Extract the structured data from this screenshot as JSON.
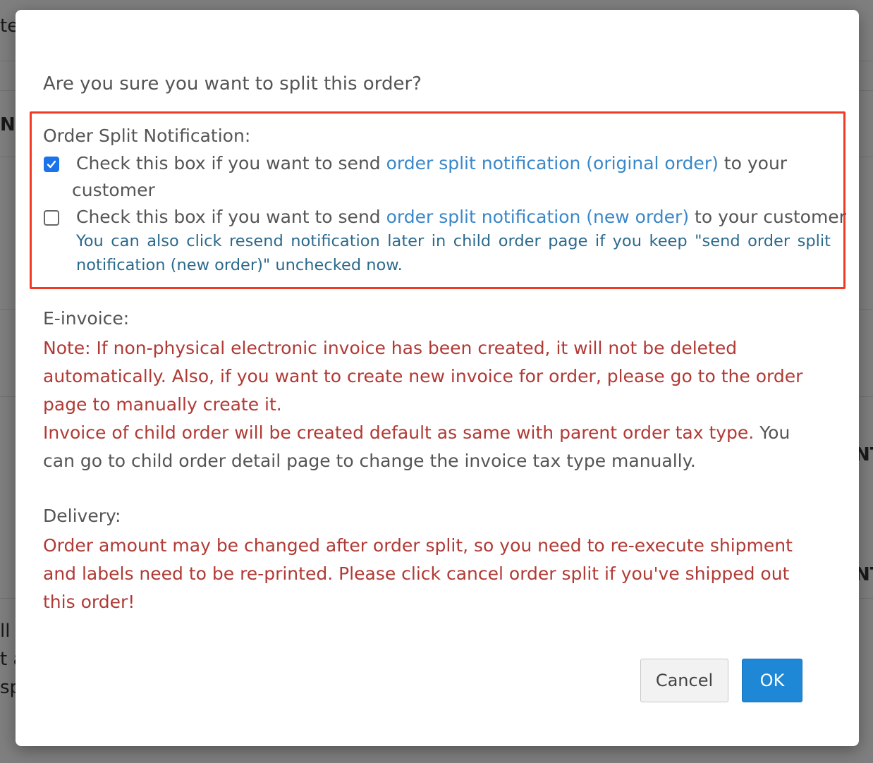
{
  "background": {
    "fragments": [
      "te",
      "Na",
      "NT",
      "NT",
      "ll c",
      "t a",
      "sp"
    ]
  },
  "dialog": {
    "question": "Are you sure you want to split this order?",
    "notification": {
      "title": "Order Split Notification:",
      "option1": {
        "checked": true,
        "prefix": "Check this box if you want to send ",
        "link": "order split notification (original order)",
        "suffix": " to your",
        "continuation": "customer"
      },
      "option2": {
        "checked": false,
        "prefix": "Check this box if you want to send ",
        "link": "order split notification (new order)",
        "suffix": " to your customer"
      },
      "info_line1": "You can also click resend notification later in child order page if you keep \"send order split",
      "info_line2": "notification (new order)\" unchecked now."
    },
    "einvoice": {
      "label": "E-invoice:",
      "note_lines": [
        "Note: If non-physical electronic invoice has been created, it will not be deleted",
        "automatically. Also, if you want to create new invoice for order, please go to the order",
        "page to manually create it."
      ],
      "tax_red": "Invoice of child order will be created default as same with parent order tax type.",
      "tax_gray_1": " You",
      "tax_gray_2": "can go to child order detail page to change the invoice tax type manually."
    },
    "delivery": {
      "label": "Delivery:",
      "note_lines": [
        "Order amount may be changed after order split, so you need to re-execute shipment",
        "and labels need to be re-printed. Please click cancel order split if you've shipped out",
        "this order!"
      ]
    },
    "buttons": {
      "cancel": "Cancel",
      "ok": "OK"
    }
  },
  "colors": {
    "highlight": "#f03a24",
    "link": "#3a87c9",
    "warning": "#b03a35",
    "primary": "#1e88d6"
  }
}
